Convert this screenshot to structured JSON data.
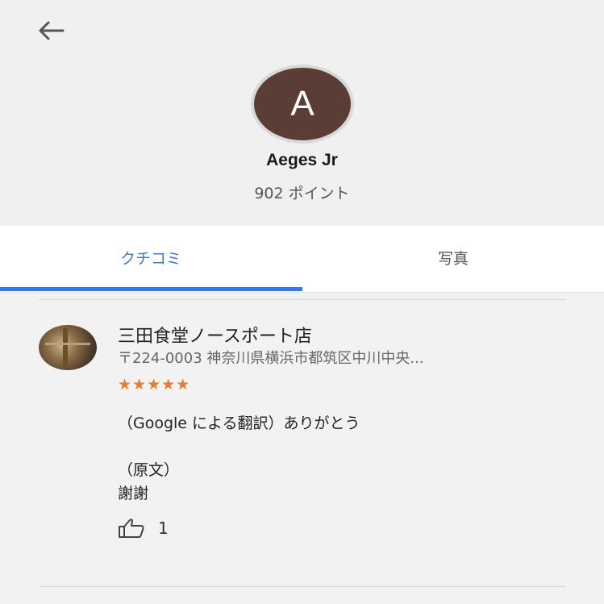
{
  "header": {
    "avatar_letter": "A",
    "user_name": "Aeges Jr",
    "points": "902 ポイント"
  },
  "tabs": [
    {
      "label": "クチコミ",
      "active": true
    },
    {
      "label": "写真",
      "active": false
    }
  ],
  "review": {
    "place_name": "三田食堂ノースポート店",
    "address": "〒224-0003 神奈川県横浜市都筑区中川中央...",
    "stars": "★★★★★",
    "rating": 5,
    "translated_text": "（Google による翻訳）ありがとう",
    "original_label": "（原文）",
    "original_text": "謝謝",
    "like_count": "1"
  },
  "colors": {
    "accent": "#3b78d8",
    "star": "#e37c32",
    "avatar_bg": "#5a3e35"
  },
  "icons": {
    "back": "arrow-left-icon",
    "like": "thumbs-up-icon"
  }
}
